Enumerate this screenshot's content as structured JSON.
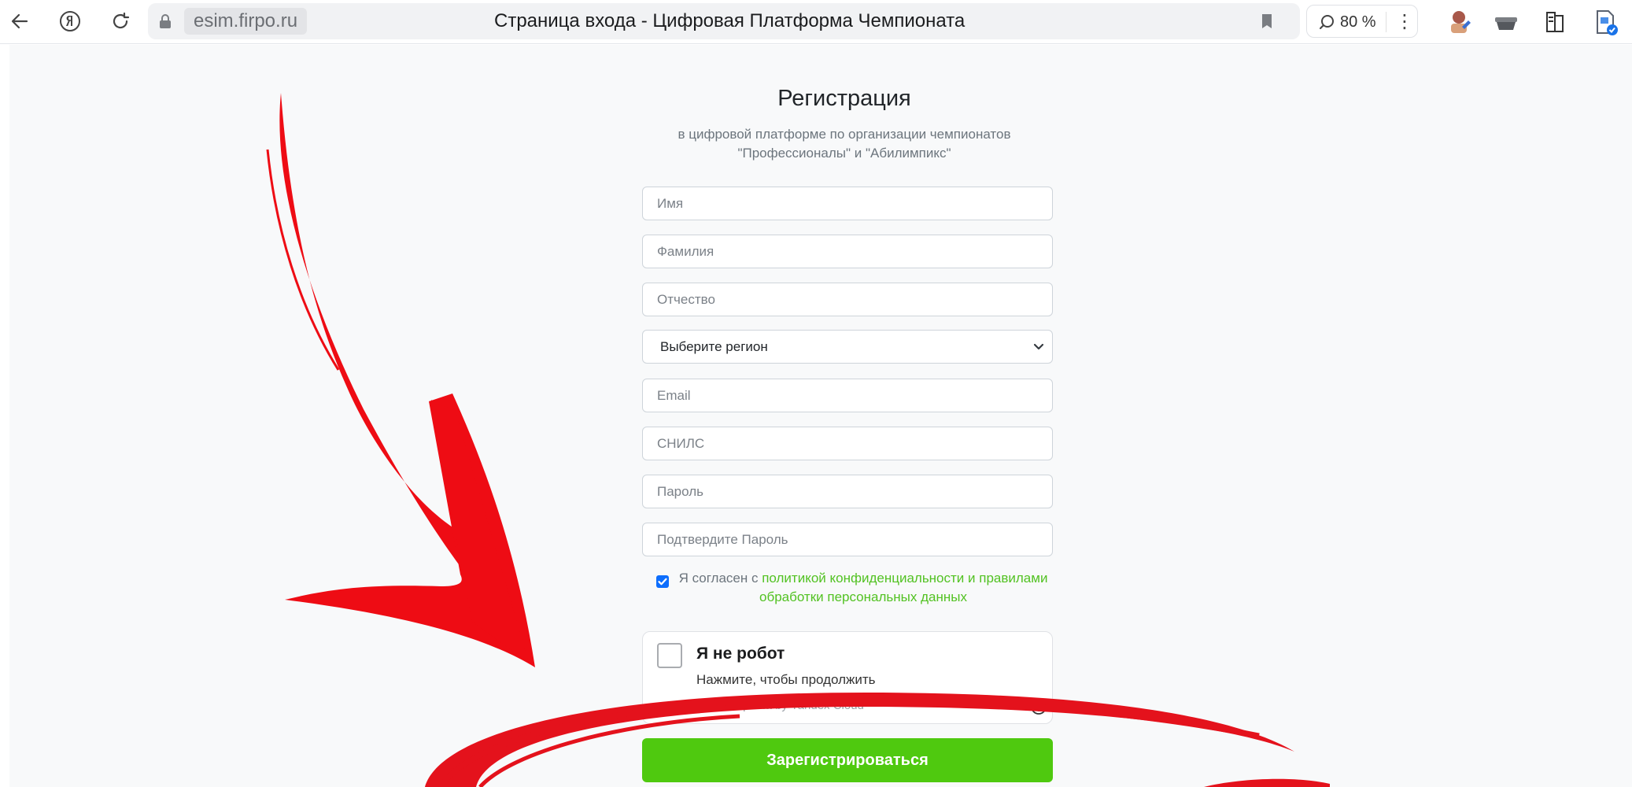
{
  "browser": {
    "domain": "esim.firpo.ru",
    "tab_title": "Страница входа - Цифровая Платформа Чемпионата",
    "zoom": "80 %",
    "icons": [
      "back-arrow-icon",
      "yandex-logo-icon",
      "reload-icon",
      "lock-icon",
      "bookmark-icon",
      "zoom-icon",
      "kebab-menu-icon"
    ]
  },
  "form": {
    "title": "Регистрация",
    "subtitle_line1": "в цифровой платформе по организации чемпионатов",
    "subtitle_line2": "\"Профессионалы\" и \"Абилимпикс\"",
    "placeholders": {
      "first_name": "Имя",
      "last_name": "Фамилия",
      "patronymic": "Отчество",
      "email": "Email",
      "snils": "СНИЛС",
      "password": "Пароль",
      "confirm_password": "Подтвердите Пароль"
    },
    "region_selected": "Выберите регион",
    "consent": {
      "checked": true,
      "prefix": "Я согласен с ",
      "link_text": "политикой конфиденциальности и правилами обработки персональных данных"
    },
    "captcha": {
      "title": "Я не робот",
      "hint": "Нажмите, чтобы продолжить",
      "provider": "SmartCaptcha by Yandex Cloud"
    },
    "submit_label": "Зарегистрироваться"
  },
  "colors": {
    "accent_green": "#4fc90f",
    "link_green": "#52c222",
    "checkbox_blue": "#0d6efd",
    "annotation_red": "#e4121c"
  }
}
